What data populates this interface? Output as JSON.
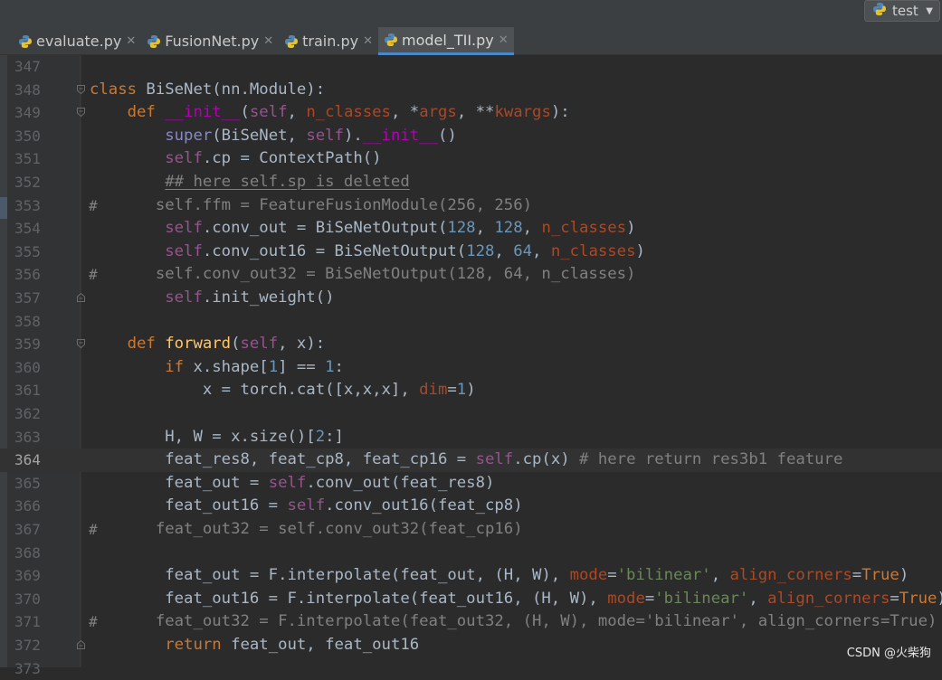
{
  "run_config": {
    "label": "test",
    "icon": "python-icon"
  },
  "tabs": [
    {
      "label": "evaluate.py",
      "active": false
    },
    {
      "label": "FusionNet.py",
      "active": false
    },
    {
      "label": "train.py",
      "active": false
    },
    {
      "label": "model_TII.py",
      "active": true
    }
  ],
  "editor": {
    "current_line": 364,
    "lines": [
      {
        "n": "347",
        "t": ""
      },
      {
        "n": "348",
        "t": "class BiSeNet(nn.Module):"
      },
      {
        "n": "349",
        "t": "    def __init__(self, n_classes, *args, **kwargs):"
      },
      {
        "n": "350",
        "t": "        super(BiSeNet, self).__init__()"
      },
      {
        "n": "351",
        "t": "        self.cp = ContextPath()"
      },
      {
        "n": "352",
        "t": "        ## here self.sp is deleted"
      },
      {
        "n": "353",
        "t": "#        self.ffm = FeatureFusionModule(256, 256)"
      },
      {
        "n": "354",
        "t": "        self.conv_out = BiSeNetOutput(128, 128, n_classes)"
      },
      {
        "n": "355",
        "t": "        self.conv_out16 = BiSeNetOutput(128, 64, n_classes)"
      },
      {
        "n": "356",
        "t": "#        self.conv_out32 = BiSeNetOutput(128, 64, n_classes)"
      },
      {
        "n": "357",
        "t": "        self.init_weight()"
      },
      {
        "n": "358",
        "t": ""
      },
      {
        "n": "359",
        "t": "    def forward(self, x):"
      },
      {
        "n": "360",
        "t": "        if x.shape[1] == 1:"
      },
      {
        "n": "361",
        "t": "            x = torch.cat([x,x,x], dim=1)"
      },
      {
        "n": "362",
        "t": ""
      },
      {
        "n": "363",
        "t": "        H, W = x.size()[2:]"
      },
      {
        "n": "364",
        "t": "        feat_res8, feat_cp8, feat_cp16 = self.cp(x) # here return res3b1 feature"
      },
      {
        "n": "365",
        "t": "        feat_out = self.conv_out(feat_res8)"
      },
      {
        "n": "366",
        "t": "        feat_out16 = self.conv_out16(feat_cp8)"
      },
      {
        "n": "367",
        "t": "#        feat_out32 = self.conv_out32(feat_cp16)"
      },
      {
        "n": "368",
        "t": ""
      },
      {
        "n": "369",
        "t": "        feat_out = F.interpolate(feat_out, (H, W), mode='bilinear', align_corners=True)"
      },
      {
        "n": "370",
        "t": "        feat_out16 = F.interpolate(feat_out16, (H, W), mode='bilinear', align_corners=True)"
      },
      {
        "n": "371",
        "t": "#        feat_out32 = F.interpolate(feat_out32, (H, W), mode='bilinear', align_corners=True)"
      },
      {
        "n": "372",
        "t": "        return feat_out, feat_out16"
      },
      {
        "n": "373",
        "t": ""
      }
    ]
  },
  "watermark": "CSDN @火柴狗",
  "colors": {
    "background": "#2b2b2b",
    "gutter": "#313335",
    "keyword": "#cc7832",
    "self": "#94558d",
    "number": "#6897bb",
    "string": "#6a8759",
    "comment": "#808080",
    "function_name": "#ffc66d",
    "accent": "#4a88c7"
  }
}
